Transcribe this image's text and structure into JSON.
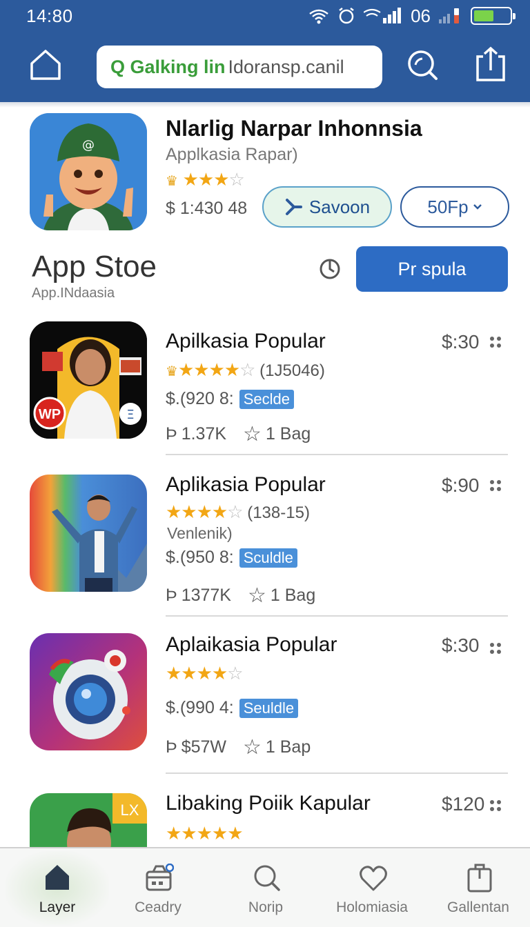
{
  "status_bar": {
    "time": "14:80",
    "signal_text": "06"
  },
  "header": {
    "search_prefix": "Q Galking lin",
    "search_text": "Idoransp.canil",
    "icons": [
      "home-icon",
      "search-icon",
      "share-icon"
    ]
  },
  "featured": {
    "title": "Nlarlig Narpar Inhonnsia",
    "subtitle": "Applkasia Rapar)",
    "rating_stars": 3,
    "price": "$ 1:430 48",
    "save_label": "Savoon",
    "size_label": "50Fp"
  },
  "section": {
    "title": "App Stoe",
    "subtitle": "App.INdaasia",
    "cta_label": "Pr spula"
  },
  "apps": [
    {
      "title": "Apilkasia Popular",
      "price": "$:30",
      "rating_stars": 4,
      "rating_count": "(1J5046)",
      "developer": "",
      "meta_price": "$.(920 8:",
      "tag": "Seclde",
      "downloads": "1.37K",
      "bag": "1 Bag",
      "badge_text": "WP"
    },
    {
      "title": "Aplikasia Popular",
      "price": "$:90",
      "rating_stars": 4,
      "rating_count": "(138-15)",
      "developer": "Venlenik)",
      "meta_price": "$.(950 8:",
      "tag": "Sculdle",
      "downloads": "1377K",
      "bag": "1 Bag",
      "badge_text": ""
    },
    {
      "title": "Aplaikasia Popular",
      "price": "$:30",
      "rating_stars": 4,
      "rating_count": "",
      "developer": "",
      "meta_price": "$.(990 4:",
      "tag": "Seuldle",
      "downloads": "$57W",
      "bag": "1 Bap",
      "badge_text": ""
    },
    {
      "title": "Libaking Poiik Kapular",
      "price": "$120",
      "rating_stars": 5,
      "badge_text": "LX"
    }
  ],
  "bottom_nav": [
    {
      "label": "Layer",
      "icon": "home-icon",
      "active": true
    },
    {
      "label": "Ceadry",
      "icon": "store-icon",
      "active": false
    },
    {
      "label": "Norip",
      "icon": "search-icon",
      "active": false
    },
    {
      "label": "Holomiasia",
      "icon": "heart-icon",
      "active": false
    },
    {
      "label": "Gallentan",
      "icon": "bag-icon",
      "active": false
    }
  ],
  "colors": {
    "header_bg": "#2c5a9c",
    "primary": "#2d6cc4",
    "star": "#f2a614",
    "tag_bg": "#4a90d9"
  }
}
